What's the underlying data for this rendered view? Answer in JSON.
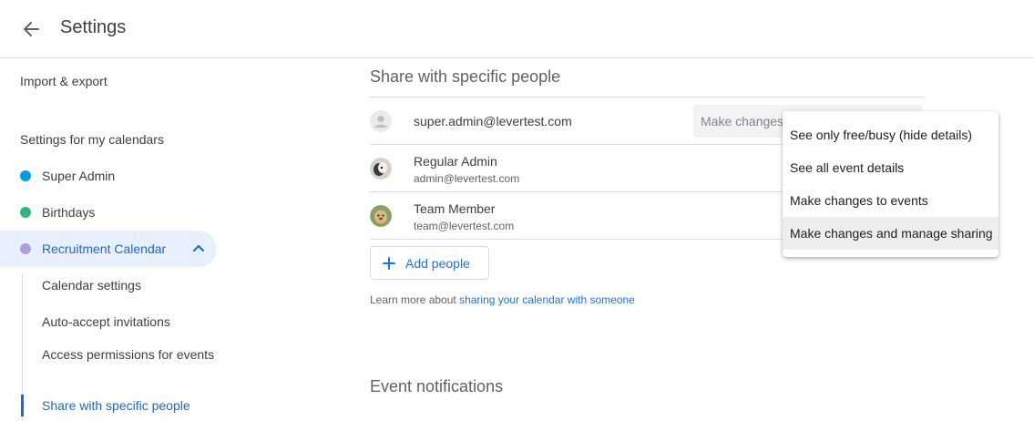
{
  "header": {
    "title": "Settings"
  },
  "sidebar": {
    "import_export": "Import & export",
    "my_calendars_heading": "Settings for my calendars",
    "calendars": [
      {
        "name": "Super Admin",
        "color": "#039be5"
      },
      {
        "name": "Birthdays",
        "color": "#33b679"
      },
      {
        "name": "Recruitment Calendar",
        "color": "#b39ddb"
      }
    ],
    "sub_items": [
      "Calendar settings",
      "Auto-accept invitations",
      "Access permissions for events",
      "Share with specific people"
    ]
  },
  "main": {
    "share_title": "Share with specific people",
    "people": [
      {
        "email": "super.admin@levertest.com",
        "permission": "Make changes"
      },
      {
        "name": "Regular Admin",
        "email": "admin@levertest.com"
      },
      {
        "name": "Team Member",
        "email": "team@levertest.com"
      }
    ],
    "add_people_label": "Add people",
    "learn_more_prefix": "Learn more about ",
    "learn_more_link": "sharing your calendar with someone",
    "notifications_title": "Event notifications"
  },
  "dropdown": {
    "options": [
      "See only free/busy (hide details)",
      "See all event details",
      "Make changes to events",
      "Make changes and manage sharing"
    ],
    "selected_index": 3
  },
  "colors": {
    "accent": "#1a73e8",
    "active_bg": "#e8f0fe",
    "active_text": "#1967d2"
  }
}
